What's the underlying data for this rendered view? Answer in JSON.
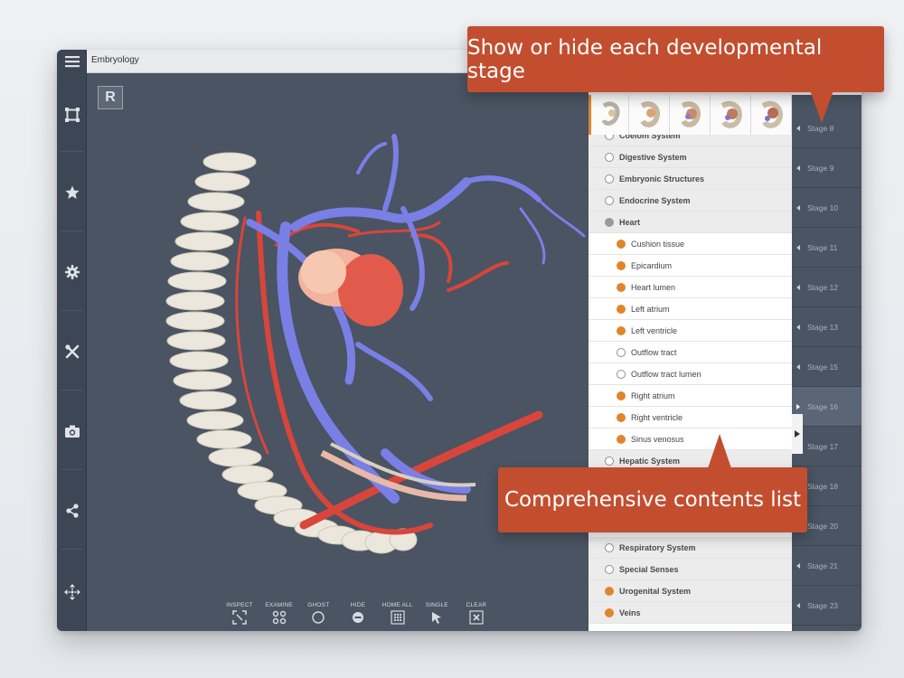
{
  "window": {
    "title": "Embryology"
  },
  "view_badge": "R",
  "left_rail": {
    "items": [
      {
        "icon": "menu-icon"
      },
      {
        "icon": "frame-icon"
      },
      {
        "icon": "star-icon"
      },
      {
        "icon": "gear-icon"
      },
      {
        "icon": "tools-icon"
      },
      {
        "icon": "camera-icon"
      },
      {
        "icon": "share-icon"
      },
      {
        "icon": "move-icon"
      }
    ]
  },
  "toolbar": {
    "inspect": "INSPECT",
    "examine": "EXAMINE",
    "ghost": "GHOST",
    "hide": "HIDE",
    "home_all": "HOME ALL",
    "single": "SINGLE",
    "clear": "CLEAR"
  },
  "contents": {
    "rows": [
      {
        "label": "Coelom System",
        "kind": "system",
        "state": "empty"
      },
      {
        "label": "Digestive System",
        "kind": "system",
        "state": "empty"
      },
      {
        "label": "Embryonic Structures",
        "kind": "system",
        "state": "empty"
      },
      {
        "label": "Endocrine System",
        "kind": "system",
        "state": "empty"
      },
      {
        "label": "Heart",
        "kind": "system",
        "state": "grey"
      },
      {
        "label": "Cushion tissue",
        "kind": "part",
        "state": "full"
      },
      {
        "label": "Epicardium",
        "kind": "part",
        "state": "full"
      },
      {
        "label": "Heart lumen",
        "kind": "part",
        "state": "full"
      },
      {
        "label": "Left atrium",
        "kind": "part",
        "state": "full"
      },
      {
        "label": "Left ventricle",
        "kind": "part",
        "state": "full"
      },
      {
        "label": "Outflow tract",
        "kind": "part",
        "state": "empty"
      },
      {
        "label": "Outflow tract lumen",
        "kind": "part",
        "state": "empty"
      },
      {
        "label": "Right atrium",
        "kind": "part",
        "state": "full"
      },
      {
        "label": "Right ventricle",
        "kind": "part",
        "state": "full"
      },
      {
        "label": "Sinus venosus",
        "kind": "part",
        "state": "full"
      },
      {
        "label": "Hepatic System",
        "kind": "system",
        "state": "empty"
      },
      {
        "label": "Respiratory System",
        "kind": "system",
        "state": "empty"
      },
      {
        "label": "Special Senses",
        "kind": "system",
        "state": "empty"
      },
      {
        "label": "Urogenital System",
        "kind": "system",
        "state": "full"
      },
      {
        "label": "Veins",
        "kind": "system",
        "state": "full"
      }
    ]
  },
  "stages": [
    {
      "label": "Stage 8"
    },
    {
      "label": "Stage 9"
    },
    {
      "label": "Stage 10"
    },
    {
      "label": "Stage 11"
    },
    {
      "label": "Stage 12"
    },
    {
      "label": "Stage 13"
    },
    {
      "label": "Stage 15"
    },
    {
      "label": "Stage 16",
      "active": true
    },
    {
      "label": "Stage 17"
    },
    {
      "label": "Stage 18"
    },
    {
      "label": "Stage 20"
    },
    {
      "label": "Stage 21"
    },
    {
      "label": "Stage 23"
    }
  ],
  "callouts": {
    "stages": "Show or hide each developmental stage",
    "contents": "Comprehensive contents list"
  },
  "colors": {
    "accent_orange": "#e0852b",
    "callout_red": "#c24e2f",
    "viewport_bg": "#4a5462",
    "vein_blue": "#7a7fe6",
    "artery_red": "#d8453b"
  }
}
